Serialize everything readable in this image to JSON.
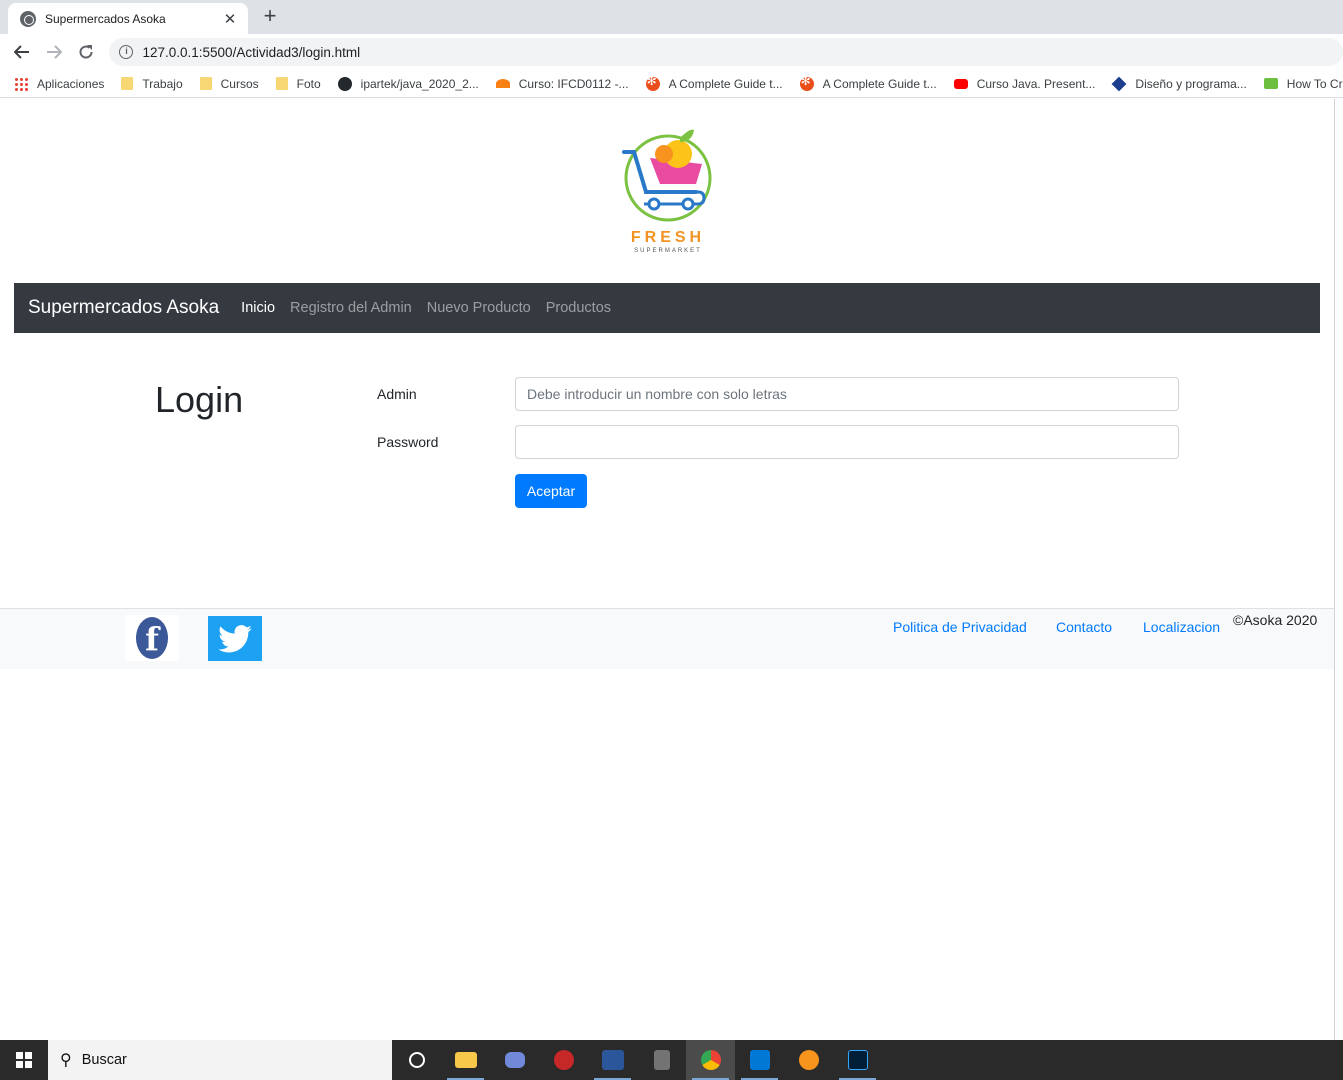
{
  "browser": {
    "tab_title": "Supermercados Asoka",
    "tab_close": "✕",
    "new_tab": "+",
    "url": "127.0.0.1:5500/Actividad3/login.html",
    "bookmarks": [
      {
        "label": "Aplicaciones",
        "icon": "apps-icon"
      },
      {
        "label": "Trabajo",
        "icon": "folder-icon"
      },
      {
        "label": "Cursos",
        "icon": "folder-icon"
      },
      {
        "label": "Foto",
        "icon": "folder-icon"
      },
      {
        "label": "ipartek/java_2020_2...",
        "icon": "github-icon"
      },
      {
        "label": "Curso: IFCD0112 -...",
        "icon": "moodle-icon"
      },
      {
        "label": "A Complete Guide t...",
        "icon": "star-icon"
      },
      {
        "label": "A Complete Guide t...",
        "icon": "star-icon"
      },
      {
        "label": "Curso Java. Present...",
        "icon": "youtube-icon"
      },
      {
        "label": "Diseño y programa...",
        "icon": "diamond-icon"
      },
      {
        "label": "How To Cr",
        "icon": "green-icon"
      }
    ]
  },
  "logo": {
    "title": "FRESH",
    "subtitle": "SUPERMARKET"
  },
  "navbar": {
    "brand": "Supermercados Asoka",
    "links": [
      "Inicio",
      "Registro del Admin",
      "Nuevo Producto",
      "Productos"
    ]
  },
  "login": {
    "title": "Login",
    "admin_label": "Admin",
    "admin_placeholder": "Debe introducir un nombre con solo letras",
    "password_label": "Password",
    "submit": "Aceptar"
  },
  "footer": {
    "links": [
      "Politica de Privacidad",
      "Contacto",
      "Localizacion"
    ],
    "copyright": "©Asoka 2020"
  },
  "taskbar": {
    "search_text": "Buscar"
  },
  "colors": {
    "navbar_bg": "#343a40",
    "primary": "#007bff",
    "footer_bg": "#f8f9fa"
  }
}
